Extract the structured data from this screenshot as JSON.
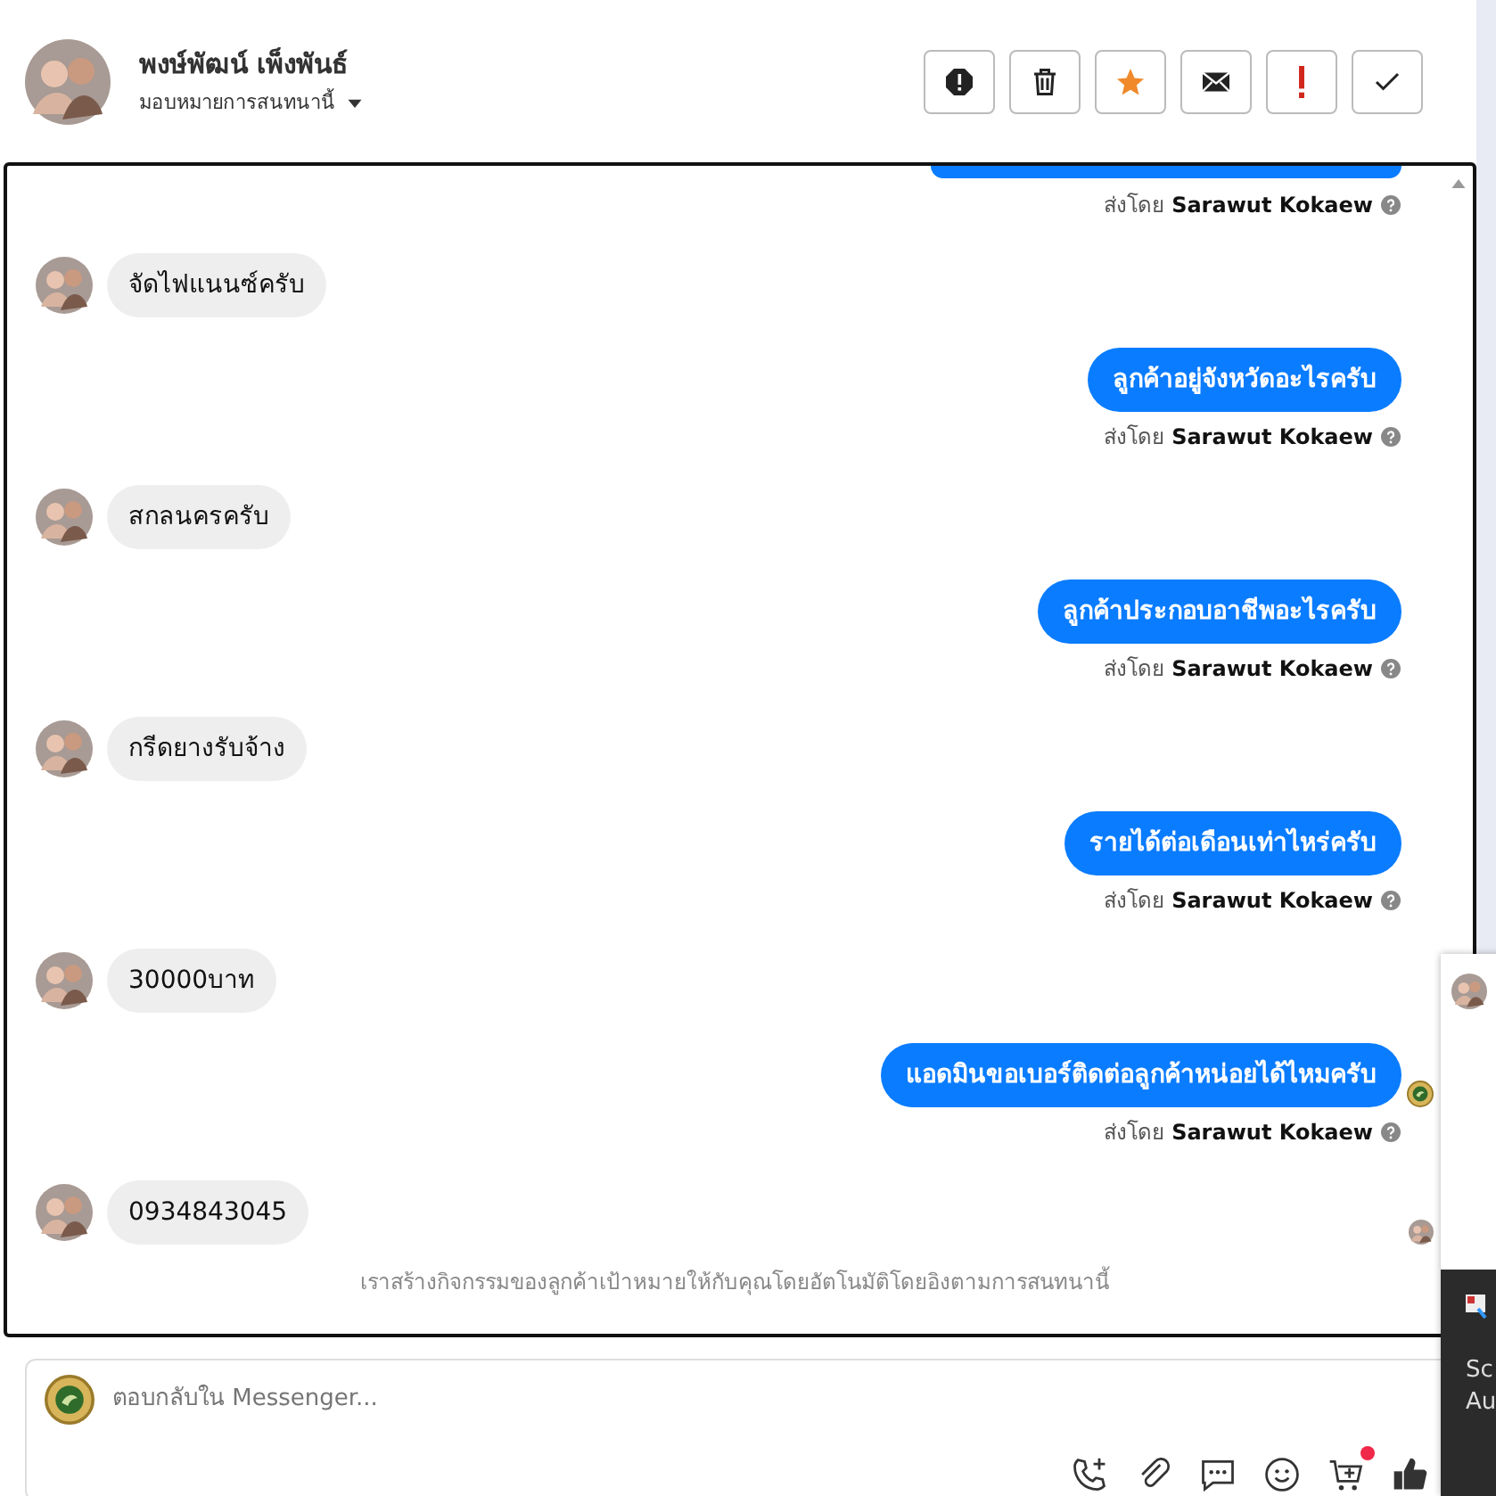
{
  "contact": {
    "name": "พงษ์พัฒน์ เพ็งพันธ์",
    "assign_label": "มอบหมายการสนทนานี้"
  },
  "actions": [
    {
      "kind": "spam"
    },
    {
      "kind": "delete"
    },
    {
      "kind": "star"
    },
    {
      "kind": "unread"
    },
    {
      "kind": "important"
    },
    {
      "kind": "done"
    }
  ],
  "messages": [
    {
      "kind": "outgoing_cut",
      "sent_by": "ส่งโดย **Sarawut Kokaew**"
    },
    {
      "kind": "incoming",
      "text": "จัดไฟแนนซ์ครับ",
      "seen": false
    },
    {
      "kind": "outgoing",
      "text": "ลูกค้าอยู่จังหวัดอะไรครับ",
      "sent_by": "ส่งโดย **Sarawut Kokaew**",
      "seen": false
    },
    {
      "kind": "incoming",
      "text": "สกลนครครับ",
      "seen": false
    },
    {
      "kind": "outgoing",
      "text": "ลูกค้าประกอบอาชีพอะไรครับ",
      "sent_by": "ส่งโดย **Sarawut Kokaew**",
      "seen": false
    },
    {
      "kind": "incoming",
      "text": "กรีดยางรับจ้าง",
      "seen": false
    },
    {
      "kind": "outgoing",
      "text": "รายได้ต่อเดือนเท่าไหร่ครับ",
      "sent_by": "ส่งโดย **Sarawut Kokaew**",
      "seen": false
    },
    {
      "kind": "incoming",
      "text": "30000บาท",
      "seen": false
    },
    {
      "kind": "outgoing",
      "text": "แอดมินขอเบอร์ติดต่อลูกค้าหน่อยได้ไหมครับ",
      "sent_by": "ส่งโดย **Sarawut Kokaew**",
      "seen": true
    },
    {
      "kind": "incoming",
      "text": "0934843045",
      "seen": true
    }
  ],
  "footer_note": "เราสร้างกิจกรรมของลูกค้าเป้าหมายให้กับคุณโดยอัตโนมัติโดยอิงตามการสนทนานี้",
  "composer": {
    "placeholder": "ตอบกลับใน Messenger...",
    "tools": [
      {
        "kind": "call",
        "badge": false
      },
      {
        "kind": "attach",
        "badge": false
      },
      {
        "kind": "saved_reply",
        "badge": false
      },
      {
        "kind": "emoji",
        "badge": false
      },
      {
        "kind": "cart",
        "badge": true
      },
      {
        "kind": "like",
        "badge": false
      }
    ]
  },
  "side_popup": {
    "lines": [
      "Sc",
      "Au"
    ]
  }
}
